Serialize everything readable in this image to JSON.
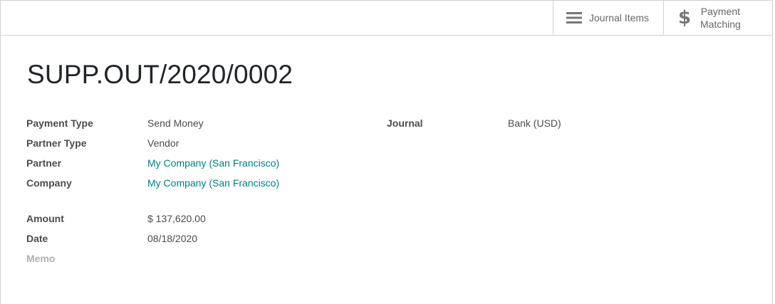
{
  "button_box": {
    "journal_items_label": "Journal Items",
    "payment_matching_line1": "Payment",
    "payment_matching_line2": "Matching",
    "journal_icon": "hamburger-list-icon",
    "matching_icon": "dollar-icon"
  },
  "record": {
    "title": "SUPP.OUT/2020/0002"
  },
  "left_group": [
    {
      "label": "Payment Type",
      "value": "Send Money"
    },
    {
      "label": "Partner Type",
      "value": "Vendor"
    },
    {
      "label": "Partner",
      "value": "My Company (San Francisco)"
    },
    {
      "label": "Company",
      "value": "My Company (San Francisco)"
    }
  ],
  "right_group": [
    {
      "label": "Journal",
      "value": "Bank (USD)"
    }
  ],
  "second_group": [
    {
      "label": "Amount",
      "value": "$ 137,620.00"
    },
    {
      "label": "Date",
      "value": "08/18/2020"
    },
    {
      "label": "Memo",
      "value": ""
    }
  ],
  "colors": {
    "link": "#017e84",
    "label": "#4c4c4c",
    "muted_label": "#b0b0b0",
    "border": "#d0d0d0"
  }
}
